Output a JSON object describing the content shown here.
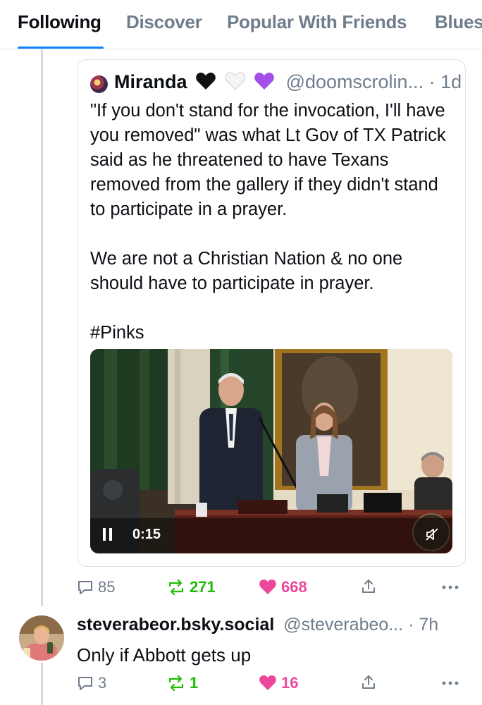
{
  "tabs": [
    {
      "label": "Following",
      "active": true
    },
    {
      "label": "Discover",
      "active": false
    },
    {
      "label": "Popular With Friends",
      "active": false
    },
    {
      "label": "Blues",
      "active": false
    }
  ],
  "quote": {
    "author_name": "Miranda",
    "emoji_hearts": [
      "black-heart",
      "white-heart",
      "purple-heart"
    ],
    "handle": "@doomscrolin...",
    "time": "· 1d",
    "paragraphs": [
      "\"If you don't stand for the invocation, I'll have you removed\" was what Lt Gov of TX Patrick said as he threatened to have Texans removed from the gallery if they didn't stand to participate in a prayer.",
      "We are not a Christian Nation & no one should have to participate in prayer.",
      "#Pinks"
    ],
    "video": {
      "time": "0:15",
      "state": "playing",
      "muted": true
    }
  },
  "quote_actions": {
    "replies": "85",
    "reposts": "271",
    "likes": "668"
  },
  "reply": {
    "author_name": "steverabeor.bsky.social",
    "handle": "@steverabeo...",
    "time": "· 7h",
    "text": "Only if Abbott gets up"
  },
  "reply_actions": {
    "replies": "3",
    "reposts": "1",
    "likes": "16"
  },
  "colors": {
    "accent": "#1083fe",
    "repost": "#20bc07",
    "like": "#ec4899",
    "muted": "#6f7d8c"
  }
}
